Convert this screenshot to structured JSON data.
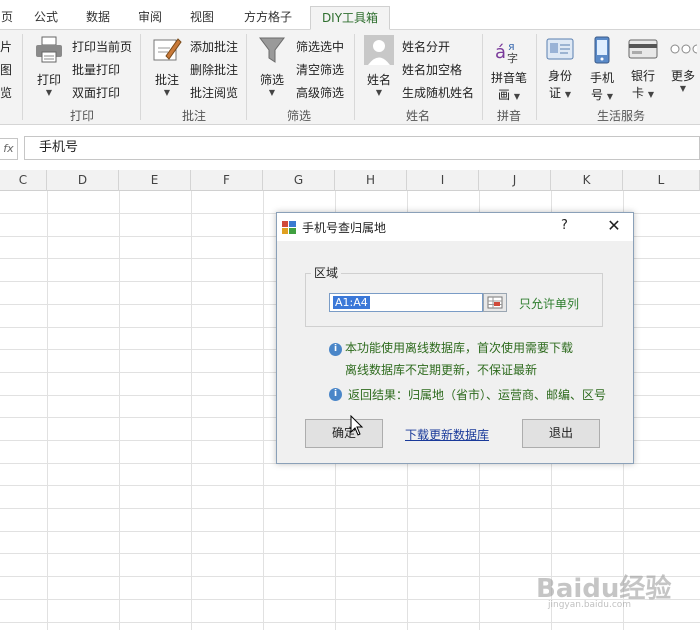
{
  "tabs": {
    "items": [
      {
        "label": "页"
      },
      {
        "label": "公式"
      },
      {
        "label": "数据"
      },
      {
        "label": "审阅"
      },
      {
        "label": "视图"
      },
      {
        "label": "方方格子"
      },
      {
        "label": "DIY工具箱"
      }
    ],
    "active": "DIY工具箱"
  },
  "ribbon": {
    "left_partial": [
      "片",
      "图",
      "览"
    ],
    "print": {
      "big_label": "打印",
      "items": [
        "打印当前页",
        "批量打印",
        "双面打印"
      ],
      "group_label": "打印"
    },
    "comment": {
      "big_label": "批注",
      "items": [
        "添加批注",
        "删除批注",
        "批注阅览"
      ],
      "group_label": "批注"
    },
    "filter": {
      "big_label": "筛选",
      "items": [
        "筛选选中",
        "清空筛选",
        "高级筛选"
      ],
      "group_label": "筛选"
    },
    "name": {
      "big_label": "姓名",
      "items": [
        "姓名分开",
        "姓名加空格",
        "生成随机姓名"
      ],
      "group_label": "姓名"
    },
    "pinyin": {
      "big_label_1": "拼音笔",
      "big_label_2": "画",
      "group_label": "拼音"
    },
    "life": {
      "buttons": [
        {
          "l1": "身份",
          "l2": "证"
        },
        {
          "l1": "手机",
          "l2": "号"
        },
        {
          "l1": "银行",
          "l2": "卡"
        },
        {
          "l1": "更多",
          "l2": ""
        }
      ],
      "group_label": "生活服务"
    }
  },
  "formula_bar": {
    "fx": "fx",
    "value": "手机号"
  },
  "grid": {
    "columns": [
      "C",
      "D",
      "E",
      "F",
      "G",
      "H",
      "I",
      "J",
      "K",
      "L"
    ]
  },
  "dialog": {
    "title": "手机号查归属地",
    "help": "?",
    "close": "✕",
    "region_legend": "区域",
    "range_value": "A1:A4",
    "only_single_col": "只允许单列",
    "note1_line1": "本功能使用离线数据库，首次使用需要下载",
    "note1_line2": "离线数据库不定期更新，不保证最新",
    "note2": "返回结果：归属地（省市）、运营商、邮编、区号",
    "ok_label": "确定",
    "download_link": "下载更新数据库",
    "exit_label": "退出"
  },
  "watermark": {
    "main": "Baidu经验",
    "sub": "jingyan.baidu.com"
  }
}
